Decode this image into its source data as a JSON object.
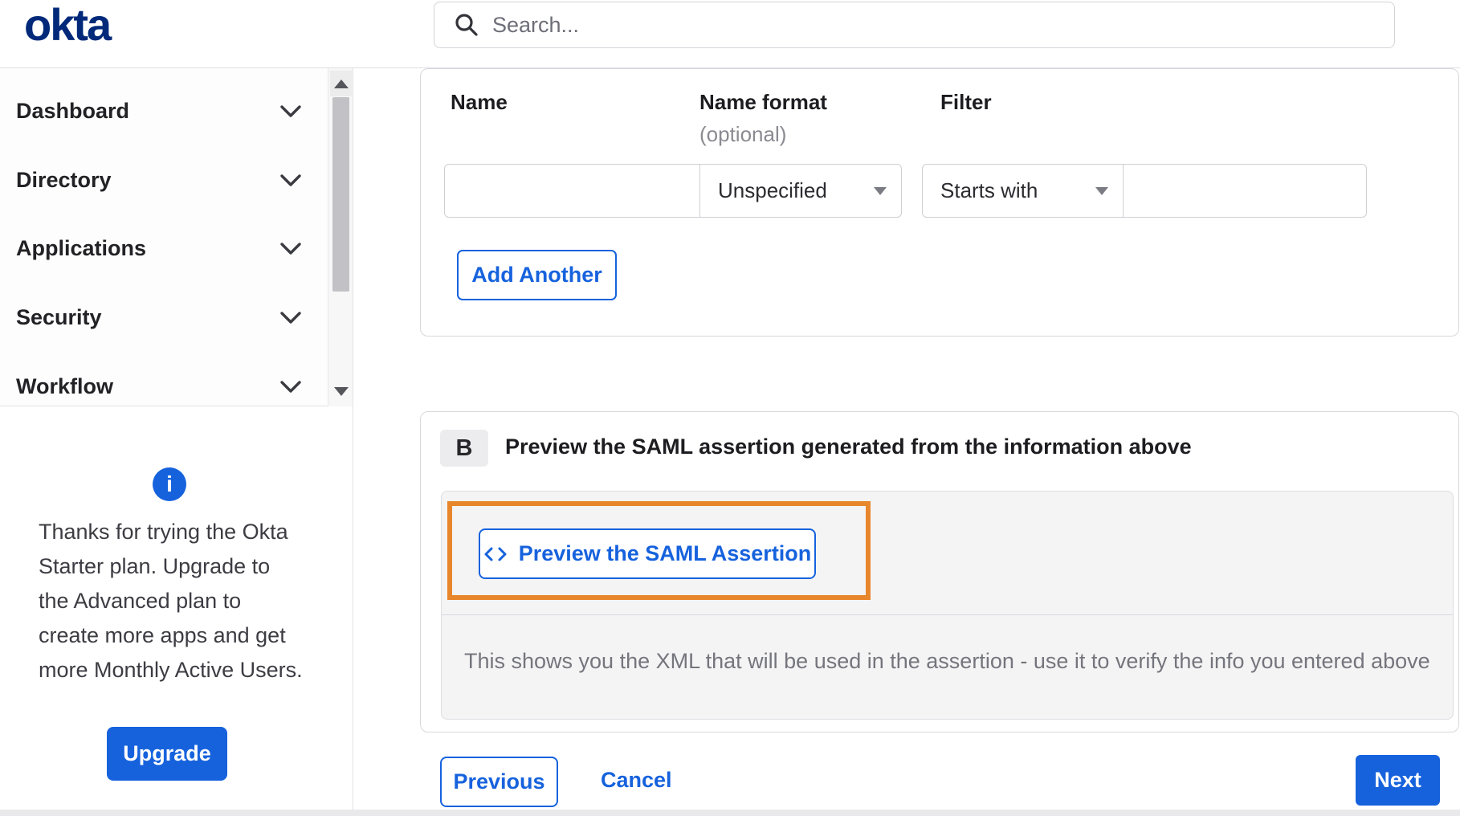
{
  "header": {
    "logo": "okta",
    "search_placeholder": "Search..."
  },
  "sidebar": {
    "items": [
      {
        "label": "Dashboard"
      },
      {
        "label": "Directory"
      },
      {
        "label": "Applications"
      },
      {
        "label": "Security"
      },
      {
        "label": "Workflow"
      }
    ],
    "promo": {
      "lines": [
        "Thanks for trying the Okta",
        "Starter plan. Upgrade to",
        "the Advanced plan to",
        "create more apps and get",
        "more Monthly Active Users."
      ],
      "upgrade_label": "Upgrade",
      "info_icon_glyph": "i"
    }
  },
  "attribute_form": {
    "columns": {
      "name_label": "Name",
      "name_format_label": "Name format",
      "name_format_optional": "(optional)",
      "filter_label": "Filter"
    },
    "row": {
      "name_value": "",
      "name_format_selected": "Unspecified",
      "filter_op_selected": "Starts with",
      "filter_value": ""
    },
    "add_another_label": "Add Another"
  },
  "preview_section": {
    "badge": "B",
    "title": "Preview the SAML assertion generated from the information above",
    "preview_button_label": "Preview the SAML Assertion",
    "helper_text": "This shows you the XML that will be used in the assertion - use it to verify the info you entered above"
  },
  "footer": {
    "previous_label": "Previous",
    "cancel_label": "Cancel",
    "next_label": "Next"
  },
  "colors": {
    "accent_blue": "#1662dd",
    "logo_navy": "#00297a",
    "highlight_orange": "#e8862c"
  }
}
